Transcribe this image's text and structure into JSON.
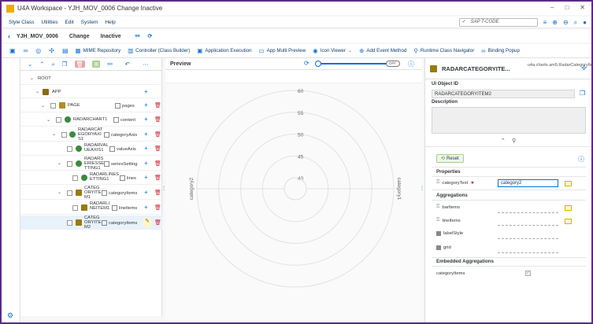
{
  "window": {
    "title": "U4A Workspace - YJH_MOV_0006 Change Inactive",
    "controls": [
      "–",
      "□",
      "✕"
    ]
  },
  "menubar": {
    "items": [
      "Style Class",
      "Utilities",
      "Edit",
      "System",
      "Help"
    ],
    "tcode_placeholder": "SAP T-CODE"
  },
  "header": {
    "back": "‹",
    "app_id": "YJH_MOV_0006",
    "mode": "Change",
    "status": "Inactive"
  },
  "toolbar": {
    "buttons": [
      "MIME Repository",
      "Controller (Class Builder)",
      "Application Execution",
      "App Multi Preview",
      "Icon Viewer",
      "Add Event Method",
      "Runtime Class Navigator",
      "Binding Popup"
    ]
  },
  "tree": {
    "nodes": [
      {
        "name": "ROOT"
      },
      {
        "name": "APP"
      },
      {
        "name": "PAGE",
        "agg": "pages"
      },
      {
        "name": "RADARCHART1",
        "agg": "content"
      },
      {
        "name": "RADARCAT EGORYAXI S1",
        "agg": "categoryAxis"
      },
      {
        "name": "RADARVAL UEAXIS1",
        "agg": "valueAxis"
      },
      {
        "name": "RADARS ERIESSE TTING1",
        "agg": "seriesSetting"
      },
      {
        "name": "RADARLINES ETTING1",
        "agg": "lines"
      },
      {
        "name": "CATEG ORYITE M1",
        "agg": "categoryItems"
      },
      {
        "name": "RADARLI NEITEM1",
        "agg": "lineItems"
      },
      {
        "name": "CATEG ORYITE M2",
        "agg": "categoryItems"
      }
    ]
  },
  "preview": {
    "title": "Preview",
    "toggle": "OFF"
  },
  "chart_data": {
    "type": "radar",
    "value_ticks": [
      40,
      45,
      50,
      55,
      60
    ],
    "categories": [
      "category1",
      "category2"
    ]
  },
  "properties": {
    "object_name": "RADARCATEGORYITE...",
    "class_name": "u4a.charts.am5.RadarCategoryItem",
    "ui_object_id_label": "UI Object ID",
    "ui_object_id": "RADARCATEGORYITEM2",
    "description_label": "Description",
    "reset_label": "Reset",
    "properties_head": "Properties",
    "category_text_label": "categoryText",
    "category_text_value": "category2",
    "aggregations_head": "Aggregations",
    "aggregations": [
      "barItems",
      "lineItems",
      "labelStyle",
      "grid"
    ],
    "embedded_head": "Embedded Aggregations",
    "embedded": [
      "categoryItems"
    ]
  },
  "colors": {
    "accent": "#0a6ed1",
    "delete": "#d32030",
    "frame": "#5b2a86"
  }
}
